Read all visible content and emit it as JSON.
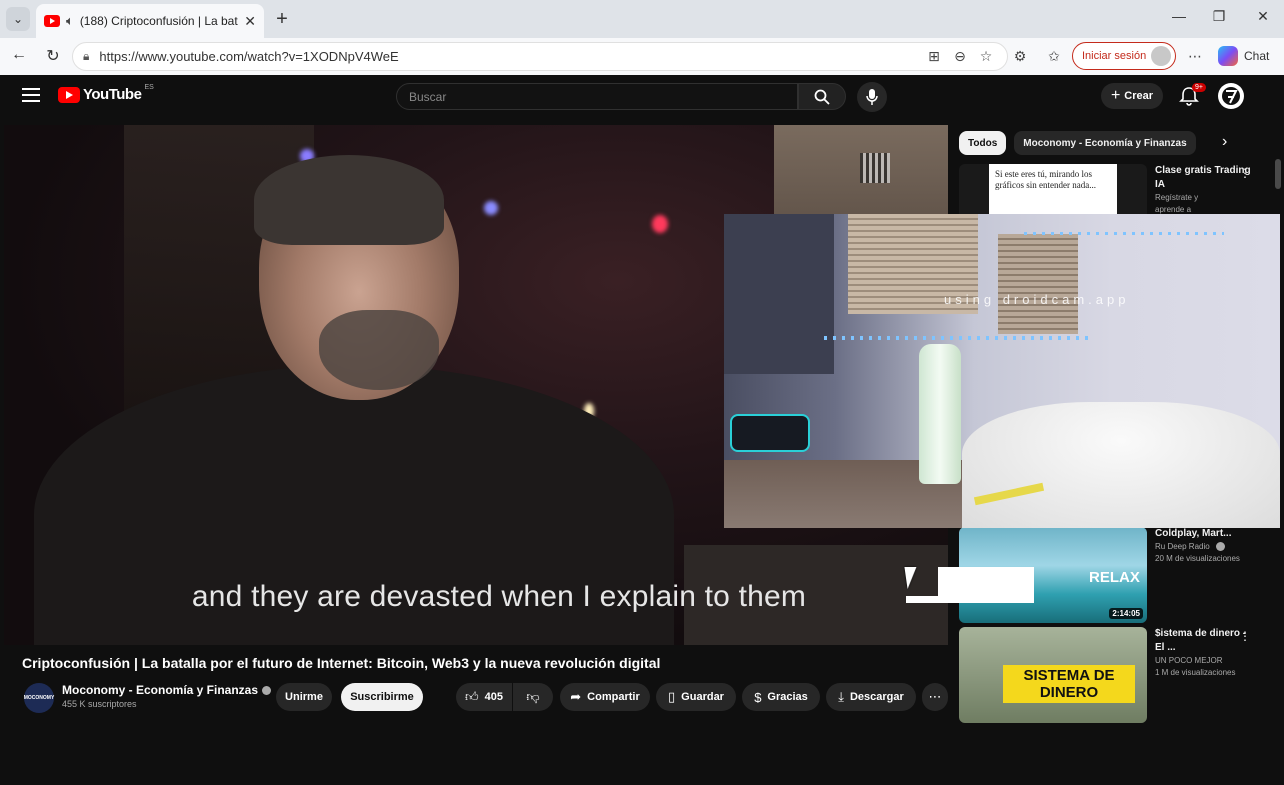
{
  "browser": {
    "tab_title": "(188) Criptoconfusión | La bat",
    "url": "https://www.youtube.com/watch?v=1XODNpV4WeE",
    "signin_label": "Iniciar sesión",
    "chat_label": "Chat",
    "icons": [
      "tab-list-icon",
      "speaker-icon",
      "close-icon",
      "plus-icon",
      "minimize-icon",
      "maximize-icon",
      "window-close-icon",
      "back-icon",
      "reload-icon",
      "site-info-icon",
      "apps-icon",
      "zoom-icon",
      "favorite-icon",
      "extensions-icon",
      "favorites-list-icon",
      "more-icon",
      "copilot-icon"
    ]
  },
  "youtube": {
    "logo_text": "YouTube",
    "logo_region": "ES",
    "search_placeholder": "Buscar",
    "create_label": "Crear",
    "notification_count": "9+",
    "video": {
      "subtitle": "and they are devasted when I explain to them",
      "title": "Criptoconfusión | La batalla por el futuro de Internet: Bitcoin, Web3 y la nueva revolución digital",
      "channel_name": "Moconomy - Economía y Finanzas",
      "channel_avatar_text": "MOCONOMY",
      "subscribers": "455 K suscriptores",
      "join_label": "Unirme",
      "subscribe_label": "Suscribirme",
      "likes": "405",
      "share_label": "Compartir",
      "save_label": "Guardar",
      "thanks_label": "Gracias",
      "download_label": "Descargar"
    },
    "chips": [
      "Todos",
      "Moconomy - Economía y Finanzas"
    ],
    "recommendations": [
      {
        "title": "Clase gratis Trading IA",
        "line2": "Regístrate y",
        "line3": "aprende a",
        "thumb_text": "Si este eres tú, mirando los gráficos sin entender nada..."
      },
      {
        "title": "Coldplay, Mart...",
        "channel": "Ru Deep Radio",
        "views": "20 M de visualizaciones",
        "duration": "2:14:05",
        "thumb_text": "RELAX"
      },
      {
        "title": "$istema de dinero -El ...",
        "channel": "UN POCO MEJOR",
        "views": "1 M de visualizaciones",
        "thumb_text": "SISTEMA DE DINERO"
      }
    ],
    "overlay_watermark": "using droidcam.app"
  }
}
